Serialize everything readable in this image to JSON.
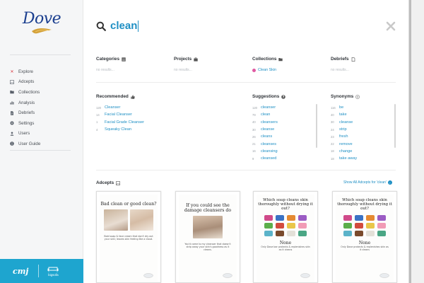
{
  "brand": {
    "logo_text": "Dove",
    "footer_logo_left": "cmj",
    "footer_logo_right": "bigsofa"
  },
  "nav": [
    {
      "label": "Explore",
      "icon": "close-icon",
      "active": true
    },
    {
      "label": "Adcepts",
      "icon": "image-icon"
    },
    {
      "label": "Collections",
      "icon": "folder-icon"
    },
    {
      "label": "Analysis",
      "icon": "bar-chart-icon"
    },
    {
      "label": "Debriefs",
      "icon": "document-icon"
    },
    {
      "label": "Settings",
      "icon": "gear-icon"
    },
    {
      "label": "Users",
      "icon": "user-icon"
    },
    {
      "label": "User Guide",
      "icon": "info-icon"
    }
  ],
  "search": {
    "value": "clean"
  },
  "sections": {
    "categories": {
      "title": "Categories",
      "empty": "no results..."
    },
    "projects": {
      "title": "Projects",
      "empty": "no results..."
    },
    "collections": {
      "title": "Collections",
      "item": "Clean Skin"
    },
    "debriefs": {
      "title": "Debriefs",
      "empty": "no results..."
    }
  },
  "recommended": {
    "title": "Recommended",
    "items": [
      {
        "count": "120",
        "term": "Cleanser"
      },
      {
        "count": "14",
        "term": "Facial Cleanser"
      },
      {
        "count": "1",
        "term": "Facial Grade Cleanser"
      },
      {
        "count": "4",
        "term": "Squeaky Clean"
      }
    ]
  },
  "suggestions": {
    "title": "Suggestions",
    "items": [
      {
        "count": "120",
        "term": "cleanser"
      },
      {
        "count": "79",
        "term": "clean"
      },
      {
        "count": "40",
        "term": "cleansers"
      },
      {
        "count": "30",
        "term": "cleanse"
      },
      {
        "count": "26",
        "term": "cleans"
      },
      {
        "count": "21",
        "term": "cleanses"
      },
      {
        "count": "16",
        "term": "cleansing"
      },
      {
        "count": "9",
        "term": "cleansed"
      }
    ]
  },
  "synonyms": {
    "title": "Synonyms",
    "items": [
      {
        "count": "116",
        "term": "be"
      },
      {
        "count": "40",
        "term": "take"
      },
      {
        "count": "30",
        "term": "cleanse"
      },
      {
        "count": "24",
        "term": "strip"
      },
      {
        "count": "23",
        "term": "fresh"
      },
      {
        "count": "22",
        "term": "remove"
      },
      {
        "count": "18",
        "term": "change"
      },
      {
        "count": "18",
        "term": "take away"
      }
    ]
  },
  "adcepts": {
    "title": "Adcepts",
    "show_all": "Show All Adcepts for 'clean'",
    "cards": [
      {
        "headline": "Bad clean or good clean?",
        "note": "Bold soap & face cream that don't dry out your skin; leaves skin feeling like a cloud."
      },
      {
        "headline": "If you could see the damage cleansers do",
        "note": "You'd come to my cleanser that doesn't strip away your skin's goodness as it cleans."
      },
      {
        "headline": "Which soap cleans skin thoroughly without drying it out?",
        "none": "None",
        "note": "Only Dove bar protects & replenishes skin as it cleans"
      },
      {
        "headline": "Which soap cleans skin thoroughly without drying it out?",
        "none": "None",
        "note": "Only Dove protects & replenishes skin as it cleans"
      }
    ]
  },
  "colors": {
    "accent": "#1e8fc4",
    "sidebar_footer": "#1ea5cf",
    "logo": "#1b3f8f",
    "active_nav_icon": "#d9363e",
    "collection_dot": "#e05aa2"
  }
}
